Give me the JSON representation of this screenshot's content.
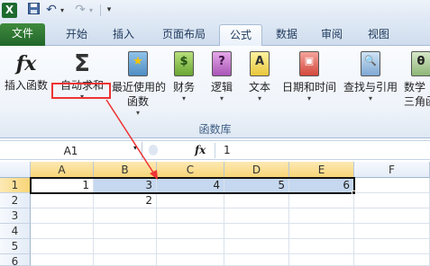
{
  "qat": {
    "logo": "X",
    "save_icon": "floppy-disk",
    "undo_icon": "↶",
    "redo_icon": "↷",
    "more_icon": "▾"
  },
  "tabs": [
    {
      "label": "文件"
    },
    {
      "label": "开始"
    },
    {
      "label": "插入"
    },
    {
      "label": "页面布局"
    },
    {
      "label": "公式"
    },
    {
      "label": "数据"
    },
    {
      "label": "审阅"
    },
    {
      "label": "视图"
    }
  ],
  "active_tab": "公式",
  "ribbon": {
    "group_label": "函数库",
    "buttons": [
      {
        "line1": "插入函数",
        "line2": "",
        "glyph": "fx"
      },
      {
        "line1": "自动求和",
        "line2": "",
        "glyph": "Σ"
      },
      {
        "line1": "最近使用的",
        "line2": "函数",
        "glyph": "★"
      },
      {
        "line1": "财务",
        "line2": "",
        "glyph": "$"
      },
      {
        "line1": "逻辑",
        "line2": "",
        "glyph": "?"
      },
      {
        "line1": "文本",
        "line2": "",
        "glyph": "A"
      },
      {
        "line1": "日期和时间",
        "line2": "",
        "glyph": "▣"
      },
      {
        "line1": "查找与引用",
        "line2": "",
        "glyph": "🔍"
      },
      {
        "line1": "数学",
        "line2": "三角函",
        "glyph": "θ"
      }
    ]
  },
  "formula_bar": {
    "name_box": "A1",
    "fx_label": "fx",
    "value": "1"
  },
  "sheet": {
    "columns": [
      "A",
      "B",
      "C",
      "D",
      "E",
      "F"
    ],
    "rows": [
      "1",
      "2",
      "3",
      "4",
      "5",
      "6"
    ],
    "cells": {
      "A1": "1",
      "B1": "3",
      "C1": "4",
      "D1": "5",
      "E1": "6",
      "B2": "2"
    }
  },
  "colors": {
    "accent": "#e33333",
    "file_tab": "#2e7d32",
    "selection": "#c5d8ef"
  }
}
